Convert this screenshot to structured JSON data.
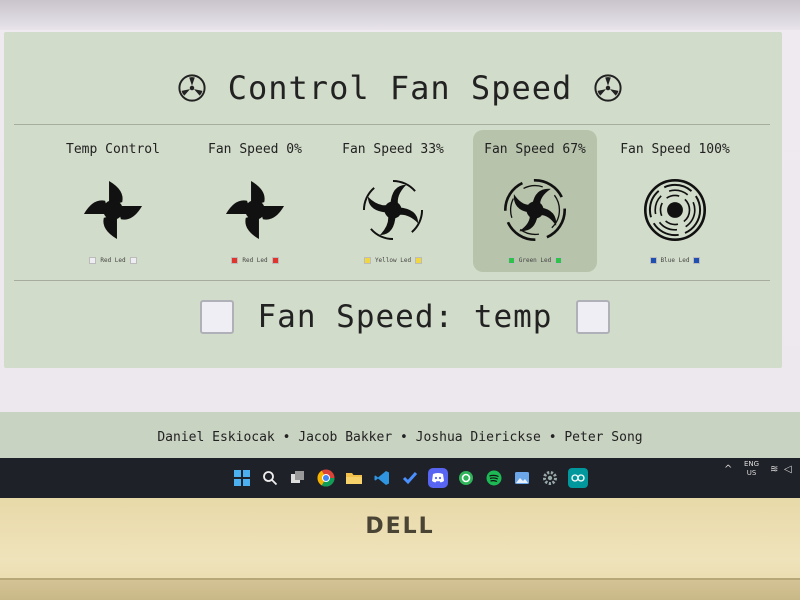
{
  "page": {
    "title": "Control Fan Speed",
    "status_label": "Fan Speed: temp",
    "credits": "Daniel Eskiocak • Jacob Bakker • Joshua Dierickse • Peter Song"
  },
  "modes": [
    {
      "label": "Temp Control",
      "led": "Red Led",
      "led_color": "#eeeef2",
      "fan": "four-blade"
    },
    {
      "label": "Fan Speed 0%",
      "led": "Red Led",
      "led_color": "#e0342c",
      "fan": "four-blade"
    },
    {
      "label": "Fan Speed 33%",
      "led": "Yellow Led",
      "led_color": "#f0d640",
      "fan": "spin-slow"
    },
    {
      "label": "Fan Speed 67%",
      "led": "Green Led",
      "led_color": "#2ec24a",
      "fan": "spin-medium"
    },
    {
      "label": "Fan Speed 100%",
      "led": "Blue Led",
      "led_color": "#1f4fb0",
      "fan": "spin-fast"
    }
  ],
  "active_mode": "Fan Speed 67%",
  "taskbar": {
    "apps": [
      "windows-start-icon",
      "search-icon",
      "task-view-icon",
      "chrome-icon",
      "file-explorer-icon",
      "vscode-icon",
      "todo-icon",
      "discord-icon",
      "app-icon",
      "spotify-icon",
      "photos-icon",
      "settings-icon",
      "arduino-icon"
    ],
    "language": "ENG",
    "region": "US"
  },
  "laptop": {
    "brand": "DELL"
  },
  "colors": {
    "panel_bg": "#d2dcca",
    "active_card_bg": "#b7c3ab",
    "taskbar_bg": "#1f2128",
    "bezel": "#efe3bb"
  }
}
